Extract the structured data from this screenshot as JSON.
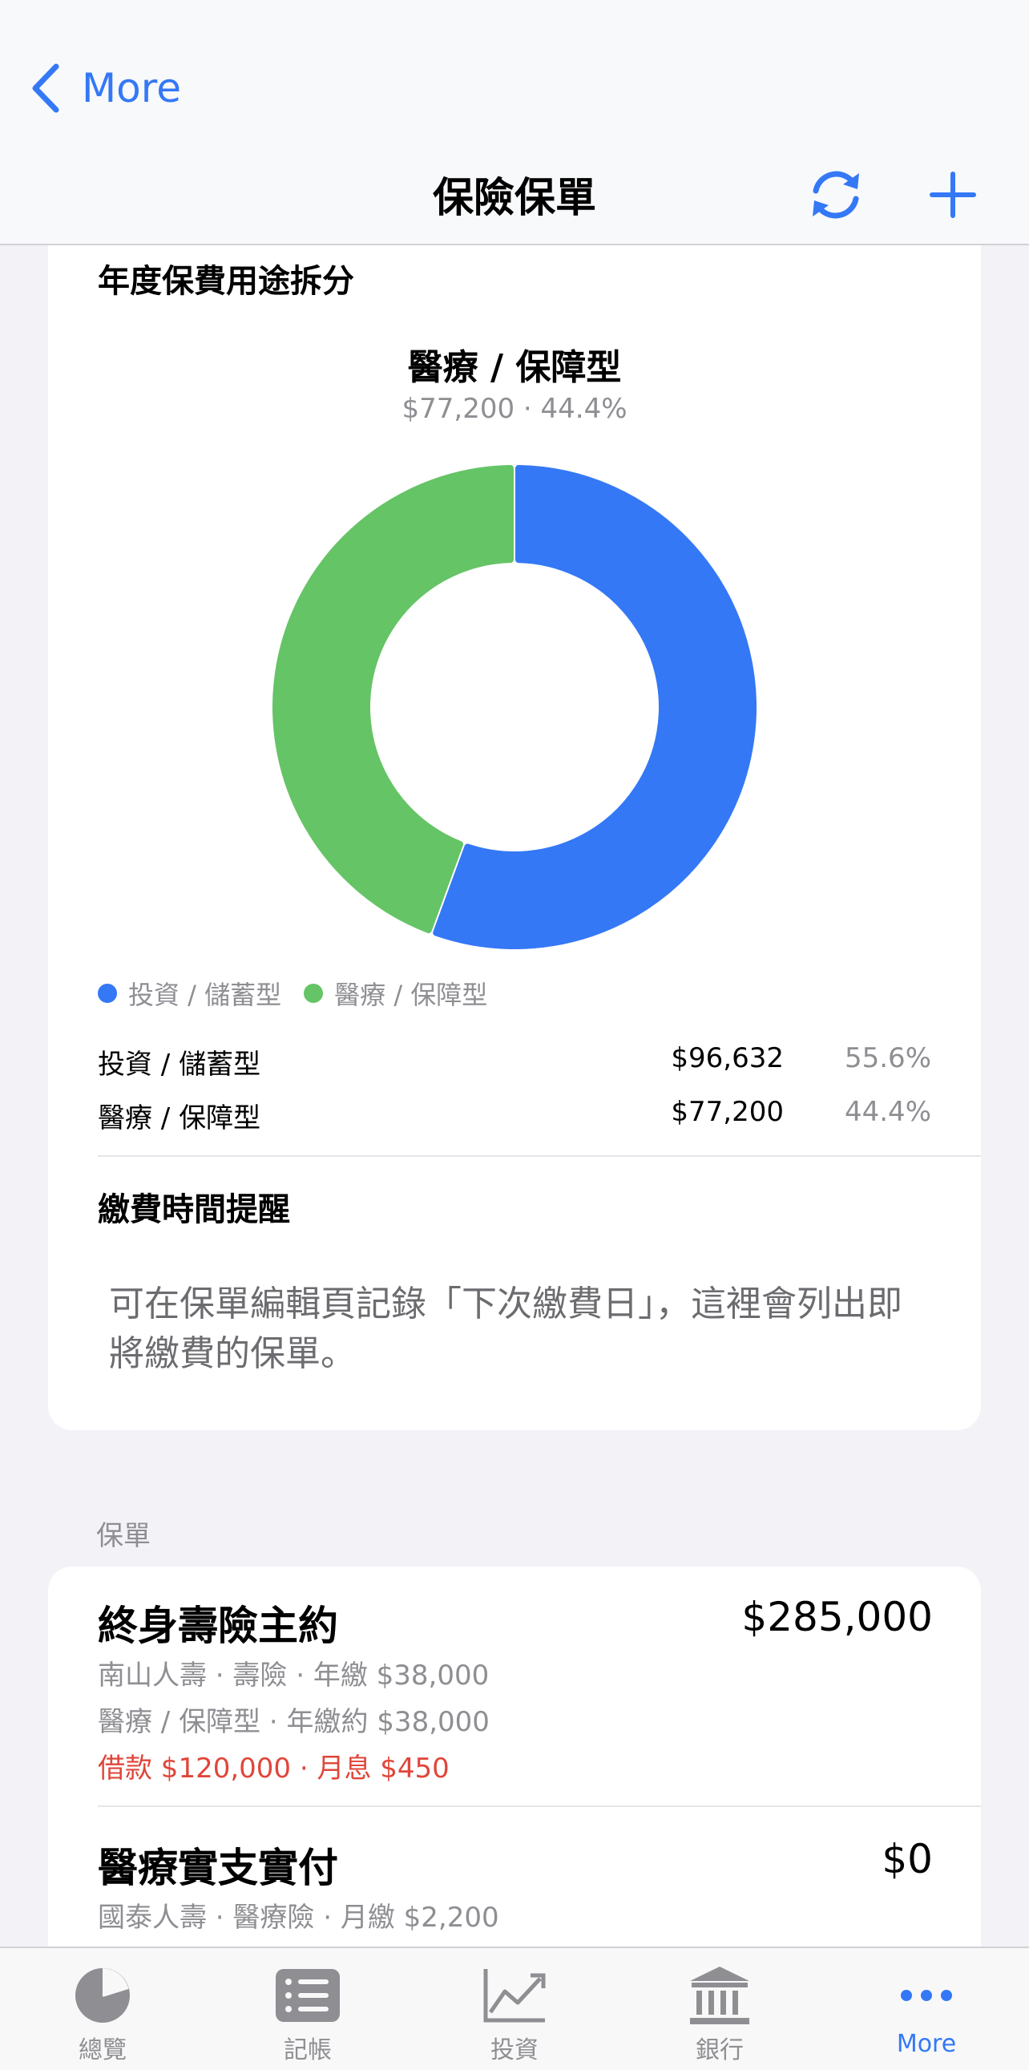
{
  "nav": {
    "back_label": "More",
    "title": "保險保單"
  },
  "breakdown": {
    "section_title": "年度保費用途拆分",
    "selected_title": "醫療 / 保障型",
    "selected_subtitle": "$77,200 · 44.4%",
    "legend": [
      "投資 / 儲蓄型",
      "醫療 / 保障型"
    ],
    "rows": [
      {
        "name": "投資 / 儲蓄型",
        "amount": "$96,632",
        "percent": "55.6%"
      },
      {
        "name": "醫療 / 保障型",
        "amount": "$77,200",
        "percent": "44.4%"
      }
    ]
  },
  "chart_data": {
    "type": "pie",
    "categories": [
      "投資 / 儲蓄型",
      "醫療 / 保障型"
    ],
    "values": [
      96632,
      77200
    ],
    "percents": [
      55.6,
      44.4
    ],
    "colors": [
      "#3478f6",
      "#65c466"
    ],
    "donut": true,
    "title": "醫療 / 保障型",
    "subtitle": "$77,200 · 44.4%"
  },
  "reminder": {
    "title": "繳費時間提醒",
    "text": "可在保單編輯頁記錄「下次繳費日」，這裡會列出即將繳費的保單。"
  },
  "policies": {
    "header": "保單",
    "items": [
      {
        "name": "終身壽險主約",
        "amount": "$285,000",
        "line1": "南山人壽 · 壽險 · 年繳 $38,000",
        "line2": "醫療 / 保障型 · 年繳約 $38,000",
        "loan": "借款 $120,000 · 月息 $450"
      },
      {
        "name": "醫療實支實付",
        "amount": "$0",
        "line1": "國泰人壽 · 醫療險 · 月繳 $2,200"
      }
    ]
  },
  "tabs": [
    {
      "label": "總覽",
      "icon": "pie-chart-icon"
    },
    {
      "label": "記帳",
      "icon": "list-icon"
    },
    {
      "label": "投資",
      "icon": "line-chart-icon"
    },
    {
      "label": "銀行",
      "icon": "bank-icon"
    },
    {
      "label": "More",
      "icon": "more-icon",
      "active": true
    }
  ],
  "colors": {
    "accent": "#3478f6",
    "green": "#65c466",
    "loan_red": "#e0463a"
  }
}
